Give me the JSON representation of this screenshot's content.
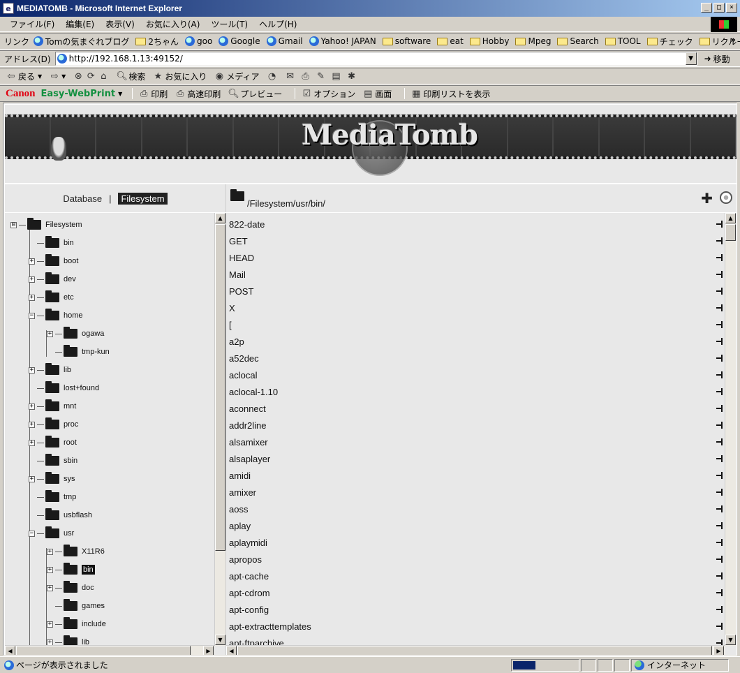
{
  "window": {
    "title": "MEDIATOMB - Microsoft Internet Explorer",
    "buttons": [
      "_",
      "□",
      "×"
    ]
  },
  "menu": [
    "ファイル(F)",
    "編集(E)",
    "表示(V)",
    "お気に入り(A)",
    "ツール(T)",
    "ヘルプ(H)"
  ],
  "links": {
    "label": "リンク",
    "items": [
      {
        "label": "Tomの気まぐれブログ",
        "icon": "ie-icon"
      },
      {
        "label": "2ちゃん",
        "icon": "folder-icon"
      },
      {
        "label": "goo",
        "icon": "ie-icon"
      },
      {
        "label": "Google",
        "icon": "ie-icon"
      },
      {
        "label": "Gmail",
        "icon": "ie-icon"
      },
      {
        "label": "Yahoo! JAPAN",
        "icon": "ie-icon"
      },
      {
        "label": "software",
        "icon": "folder-icon"
      },
      {
        "label": "eat",
        "icon": "folder-icon"
      },
      {
        "label": "Hobby",
        "icon": "folder-icon"
      },
      {
        "label": "Mpeg",
        "icon": "folder-icon"
      },
      {
        "label": "Search",
        "icon": "folder-icon"
      },
      {
        "label": "TOOL",
        "icon": "folder-icon"
      },
      {
        "label": "チェック",
        "icon": "folder-icon"
      },
      {
        "label": "リクルート",
        "icon": "folder-icon"
      }
    ],
    "more": "»"
  },
  "address": {
    "label": "アドレス(D)",
    "url": "http://192.168.1.13:49152/",
    "go_label": "移動"
  },
  "std_toolbar": {
    "back": "戻る",
    "search": "検索",
    "favorites": "お気に入り",
    "media": "メディア"
  },
  "canon_toolbar": {
    "brand": "Canon",
    "product": "Easy-WebPrint",
    "print": "印刷",
    "fast_print": "高速印刷",
    "preview": "プレビュー",
    "options": "オプション",
    "screen": "画面",
    "print_list": "印刷リストを表示"
  },
  "banner": {
    "logo_text": "MediaTomb"
  },
  "nav": {
    "database": "Database",
    "separator": "|",
    "filesystem": "Filesystem"
  },
  "path": "/Filesystem/usr/bin/",
  "tree": [
    {
      "label": "Filesystem",
      "depth": 0,
      "expander": "⊟"
    },
    {
      "label": "bin",
      "depth": 1,
      "expander": ""
    },
    {
      "label": "boot",
      "depth": 1,
      "expander": "+"
    },
    {
      "label": "dev",
      "depth": 1,
      "expander": "+"
    },
    {
      "label": "etc",
      "depth": 1,
      "expander": "+"
    },
    {
      "label": "home",
      "depth": 1,
      "expander": "−"
    },
    {
      "label": "ogawa",
      "depth": 2,
      "expander": "+"
    },
    {
      "label": "tmp-kun",
      "depth": 2,
      "expander": ""
    },
    {
      "label": "lib",
      "depth": 1,
      "expander": "+"
    },
    {
      "label": "lost+found",
      "depth": 1,
      "expander": ""
    },
    {
      "label": "mnt",
      "depth": 1,
      "expander": "+"
    },
    {
      "label": "proc",
      "depth": 1,
      "expander": "+"
    },
    {
      "label": "root",
      "depth": 1,
      "expander": "+"
    },
    {
      "label": "sbin",
      "depth": 1,
      "expander": ""
    },
    {
      "label": "sys",
      "depth": 1,
      "expander": "+"
    },
    {
      "label": "tmp",
      "depth": 1,
      "expander": ""
    },
    {
      "label": "usbflash",
      "depth": 1,
      "expander": ""
    },
    {
      "label": "usr",
      "depth": 1,
      "expander": "−"
    },
    {
      "label": "X11R6",
      "depth": 2,
      "expander": "+"
    },
    {
      "label": "bin",
      "depth": 2,
      "expander": "+",
      "selected": true
    },
    {
      "label": "doc",
      "depth": 2,
      "expander": "+"
    },
    {
      "label": "games",
      "depth": 2,
      "expander": ""
    },
    {
      "label": "include",
      "depth": 2,
      "expander": "+"
    },
    {
      "label": "lib",
      "depth": 2,
      "expander": "+"
    }
  ],
  "files": [
    "822-date",
    "GET",
    "HEAD",
    "Mail",
    "POST",
    "X",
    "[",
    "a2p",
    "a52dec",
    "aclocal",
    "aclocal-1.10",
    "aconnect",
    "addr2line",
    "alsamixer",
    "alsaplayer",
    "amidi",
    "amixer",
    "aoss",
    "aplay",
    "aplaymidi",
    "apropos",
    "apt-cache",
    "apt-cdrom",
    "apt-config",
    "apt-extracttemplates",
    "apt-ftparchive"
  ],
  "status": {
    "text": "ページが表示されました",
    "progress": 0.35,
    "zone": "インターネット"
  },
  "colors": {
    "titlebar": "#0a246a",
    "canon_red": "#e00010",
    "ewp_green": "#149040"
  }
}
